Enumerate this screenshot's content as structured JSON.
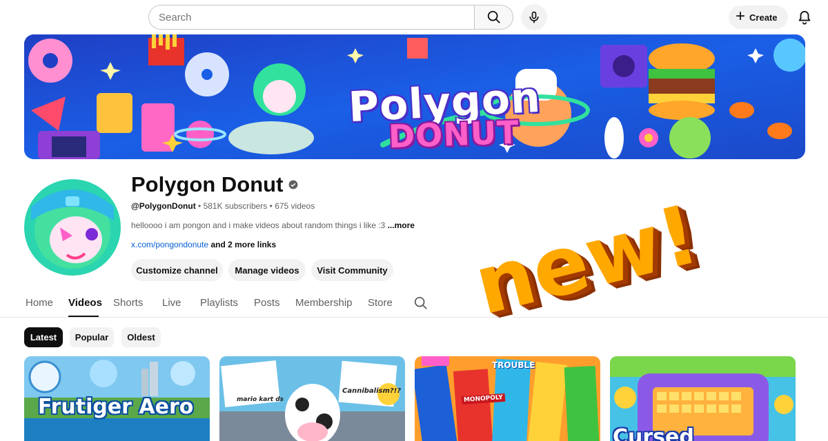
{
  "search": {
    "placeholder": "Search"
  },
  "header": {
    "create_label": "Create"
  },
  "banner": {
    "title_line1": "Polygon",
    "title_line2": "DONUT"
  },
  "channel": {
    "name": "Polygon Donut",
    "handle": "@PolygonDonut",
    "subscribers": "581K subscribers",
    "videos": "675 videos",
    "separator": "•",
    "description": "helloooo i am pongon and i make videos about random things i like :3",
    "description_more": "...more",
    "link": "x.com/pongondonute",
    "more_links": "and 2 more links"
  },
  "actions": {
    "customize": "Customize channel",
    "manage": "Manage videos",
    "community": "Visit Community"
  },
  "tabs": [
    {
      "label": "Home"
    },
    {
      "label": "Videos",
      "active": true
    },
    {
      "label": "Shorts"
    },
    {
      "label": "Live"
    },
    {
      "label": "Playlists"
    },
    {
      "label": "Posts"
    },
    {
      "label": "Membership"
    },
    {
      "label": "Store"
    }
  ],
  "filters": [
    {
      "label": "Latest",
      "active": true
    },
    {
      "label": "Popular"
    },
    {
      "label": "Oldest"
    }
  ],
  "thumbnails": [
    {
      "text": "Frutiger Aero"
    },
    {
      "text_1": "mario kart ds",
      "text_2": "Cannibalism?!?"
    },
    {
      "text_1": "TROUBLE",
      "text_2": "MONOPOLY"
    },
    {
      "text": "Cursed"
    }
  ],
  "sticker": {
    "text": "new!"
  },
  "colors": {
    "accent_dark": "#0f0f0f",
    "link": "#065fd4",
    "muted": "#606060",
    "pill_bg": "#f2f2f2",
    "sticker_fill": "#ffa800"
  }
}
